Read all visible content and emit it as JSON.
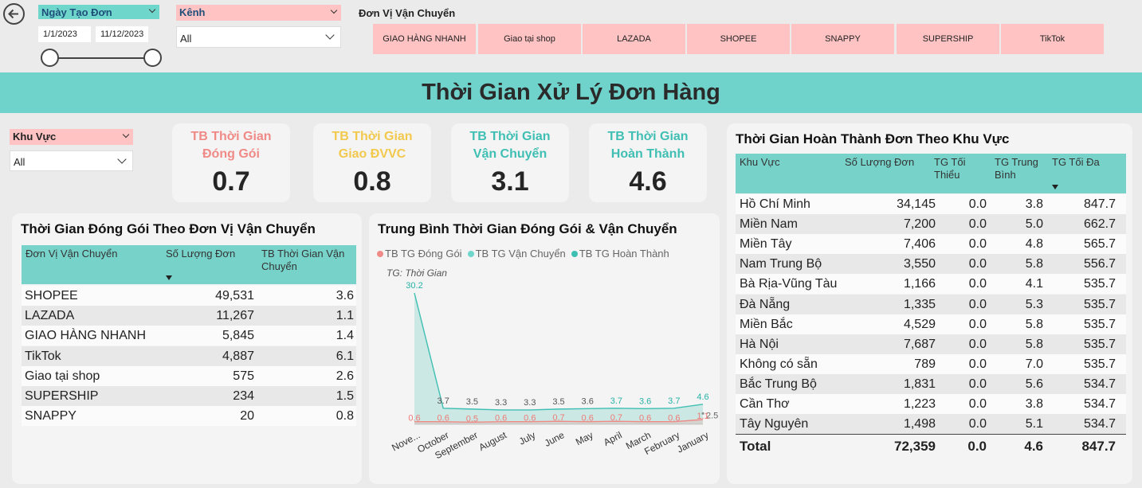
{
  "header": {
    "title": "Thời Gian Xử Lý Đơn Hàng"
  },
  "date_slicer": {
    "label": "Ngày Tạo Đơn",
    "start": "1/1/2023",
    "end": "11/12/2023"
  },
  "channel_slicer": {
    "label": "Kênh",
    "value": "All"
  },
  "carrier_slicer": {
    "label": "Đơn Vị Vận Chuyển",
    "buttons": [
      "GIAO HÀNG NHANH",
      "Giao tại shop",
      "LAZADA",
      "SHOPEE",
      "SNAPPY",
      "SUPERSHIP",
      "TikTok"
    ]
  },
  "region_slicer": {
    "label": "Khu Vực",
    "value": "All"
  },
  "kpis": [
    {
      "label": "TB Thời Gian Đóng Gói",
      "value": "0.7",
      "color": "#f08a86"
    },
    {
      "label": "TB Thời Gian Giao ĐVVC",
      "value": "0.8",
      "color": "#f2c94c"
    },
    {
      "label": "TB Thời Gian Vận Chuyển",
      "value": "3.1",
      "color": "#3fbfb3"
    },
    {
      "label": "TB Thời Gian Hoàn Thành",
      "value": "4.6",
      "color": "#3fbfb3"
    }
  ],
  "carrier_table": {
    "title": "Thời Gian Đóng Gói Theo Đơn Vị Vận Chuyển",
    "headers": [
      "Đơn Vị Vận Chuyển",
      "Số Lượng Đơn",
      "TB Thời Gian Vận Chuyển"
    ],
    "rows": [
      [
        "SHOPEE",
        "49,531",
        "3.6"
      ],
      [
        "LAZADA",
        "11,267",
        "1.1"
      ],
      [
        "GIAO HÀNG NHANH",
        "5,845",
        "1.4"
      ],
      [
        "TikTok",
        "4,887",
        "6.1"
      ],
      [
        "Giao tại shop",
        "575",
        "2.6"
      ],
      [
        "SUPERSHIP",
        "234",
        "1.5"
      ],
      [
        "SNAPPY",
        "20",
        "0.8"
      ]
    ]
  },
  "region_table": {
    "title": "Thời Gian Hoàn Thành Đơn Theo Khu Vực",
    "headers": [
      "Khu Vực",
      "Số Lượng Đơn",
      "TG Tối Thiểu",
      "TG Trung Bình",
      "TG Tối Đa"
    ],
    "rows": [
      [
        "Hồ Chí Minh",
        "34,145",
        "0.0",
        "3.8",
        "847.7"
      ],
      [
        "Miền Nam",
        "7,200",
        "0.0",
        "5.0",
        "662.7"
      ],
      [
        "Miền Tây",
        "7,406",
        "0.0",
        "4.8",
        "565.7"
      ],
      [
        "Nam Trung Bộ",
        "3,550",
        "0.0",
        "5.8",
        "556.7"
      ],
      [
        "Bà Rịa-Vũng Tàu",
        "1,166",
        "0.0",
        "4.1",
        "535.7"
      ],
      [
        "Đà Nẵng",
        "1,335",
        "0.0",
        "5.3",
        "535.7"
      ],
      [
        "Miền Bắc",
        "4,529",
        "0.0",
        "5.8",
        "535.7"
      ],
      [
        "Hà Nội",
        "7,687",
        "0.0",
        "5.8",
        "535.7"
      ],
      [
        "Không có sẵn",
        "789",
        "0.0",
        "7.0",
        "535.7"
      ],
      [
        "Bắc Trung Bộ",
        "1,831",
        "0.0",
        "5.6",
        "534.7"
      ],
      [
        "Cần Thơ",
        "1,223",
        "0.0",
        "3.8",
        "534.7"
      ],
      [
        "Tây Nguyên",
        "1,498",
        "0.0",
        "5.1",
        "534.7"
      ]
    ],
    "total": [
      "Total",
      "72,359",
      "0.0",
      "4.6",
      "847.7"
    ]
  },
  "chart_data": {
    "type": "area",
    "title": "Trung Bình Thời Gian Đóng Gói & Vận Chuyển",
    "subtitle": "TG: Thời Gian",
    "categories": [
      "Nove...",
      "October",
      "September",
      "August",
      "July",
      "June",
      "May",
      "April",
      "March",
      "February",
      "January"
    ],
    "series": [
      {
        "name": "TB TG Đóng Gói",
        "color": "#f08a86",
        "values": [
          0.6,
          0.6,
          0.5,
          0.6,
          0.6,
          0.7,
          0.6,
          0.7,
          0.6,
          0.6,
          1.1
        ]
      },
      {
        "name": "TB TG Vận Chuyển",
        "color": "#6fd6cc",
        "values": [
          null,
          null,
          null,
          null,
          null,
          null,
          null,
          null,
          null,
          null,
          2.5
        ]
      },
      {
        "name": "TB TG Hoàn Thành",
        "color": "#3fbfb3",
        "values": [
          30.2,
          3.7,
          3.5,
          3.3,
          3.3,
          3.5,
          3.6,
          3.7,
          3.6,
          3.7,
          4.6
        ]
      }
    ]
  }
}
